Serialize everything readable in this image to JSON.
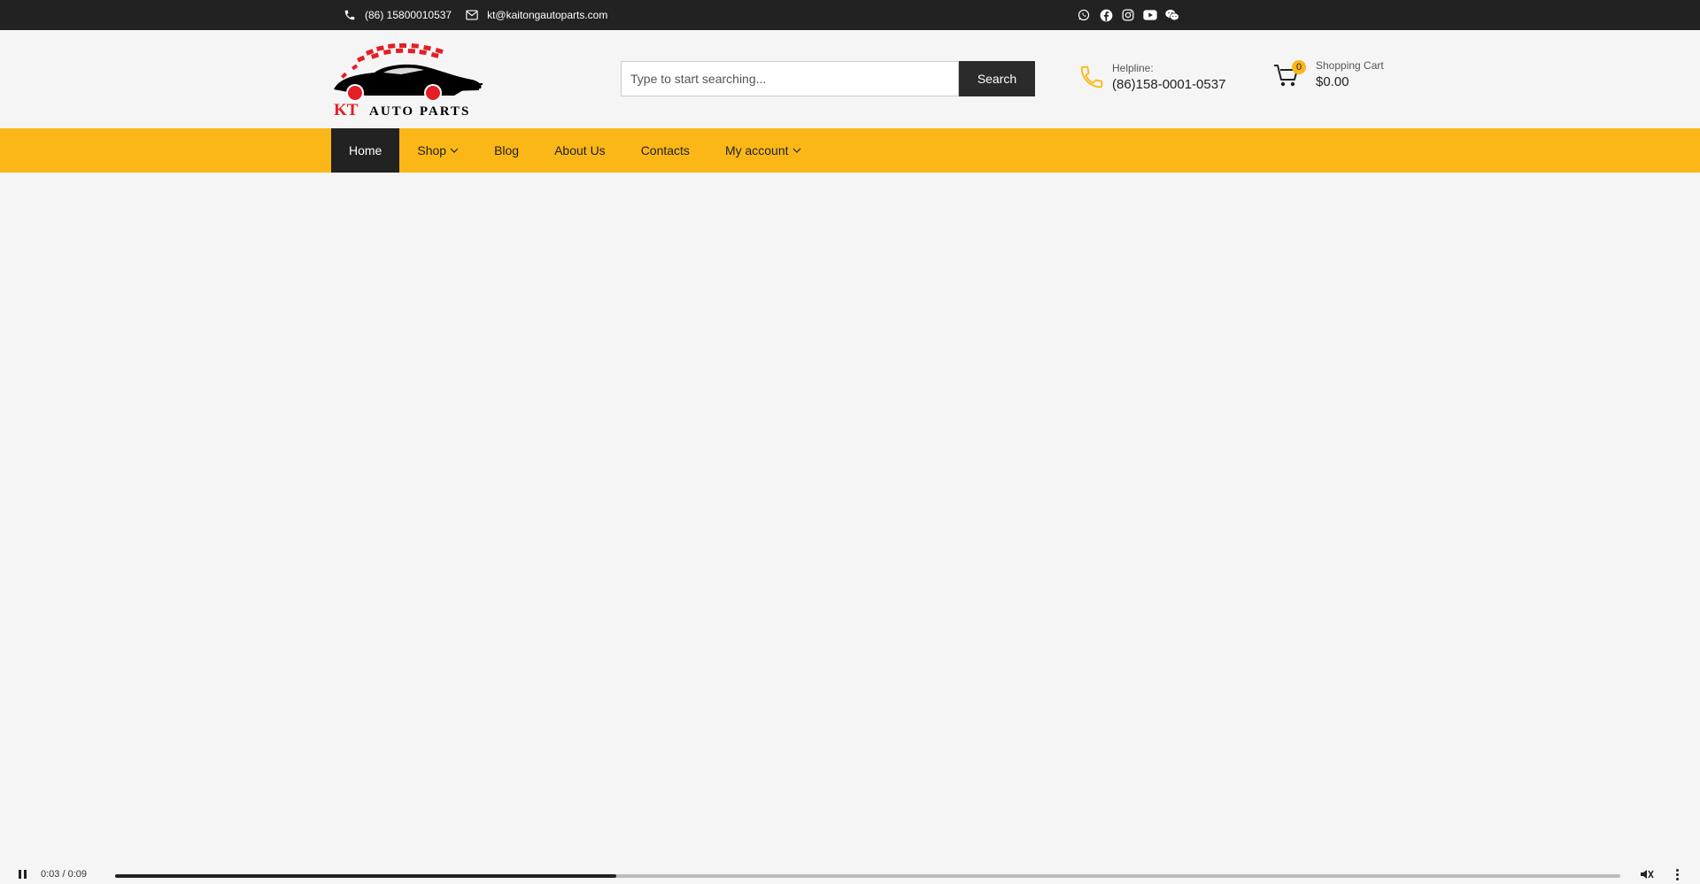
{
  "topbar": {
    "phone": "(86) 15800010537",
    "email": "kt@kaitongautoparts.com",
    "socials": [
      "whatsapp-icon",
      "facebook-icon",
      "instagram-icon",
      "youtube-icon",
      "wechat-icon"
    ]
  },
  "header": {
    "logo_text_brand": "KT",
    "logo_text_rest": "AUTO PARTS",
    "search_placeholder": "Type to start searching...",
    "search_button": "Search",
    "helpline_label": "Helpline:",
    "helpline_number": "(86)158-0001-0537",
    "cart_count": "0",
    "cart_label": "Shopping Cart",
    "cart_total": "$0.00"
  },
  "nav": {
    "items": [
      {
        "label": "Home",
        "active": true,
        "dropdown": false
      },
      {
        "label": "Shop",
        "active": false,
        "dropdown": true
      },
      {
        "label": "Blog",
        "active": false,
        "dropdown": false
      },
      {
        "label": "About Us",
        "active": false,
        "dropdown": false
      },
      {
        "label": "Contacts",
        "active": false,
        "dropdown": false
      },
      {
        "label": "My account",
        "active": false,
        "dropdown": true
      }
    ]
  },
  "video": {
    "time": "0:03 / 0:09",
    "progress_fraction": 0.333
  },
  "colors": {
    "accent": "#fbb718",
    "dark": "#222222",
    "logo_red": "#e31e24"
  }
}
